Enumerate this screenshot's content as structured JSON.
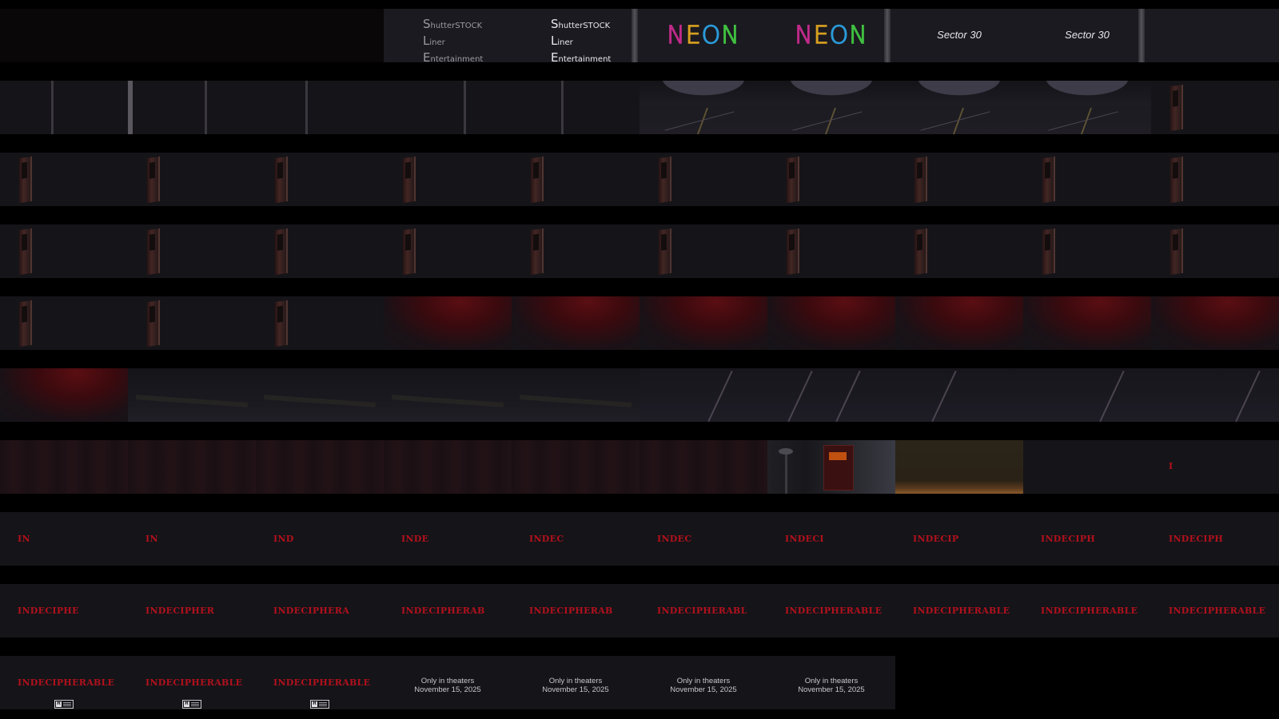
{
  "logos": {
    "shutterstock": [
      "S",
      "hutterSTOCK",
      "L",
      "iner",
      "E",
      "ntertainment"
    ],
    "neon_letters": [
      {
        "char": "N",
        "color": "#c02a8a"
      },
      {
        "char": "E",
        "color": "#d8a020"
      },
      {
        "char": "O",
        "color": "#2a9ad8"
      },
      {
        "char": "N",
        "color": "#40c040"
      }
    ],
    "sector": "Sector 30"
  },
  "title_progression_row8": [
    "IN",
    "IN",
    "IND",
    "INDE",
    "INDEC",
    "INDEC",
    "INDECI",
    "INDECIP",
    "INDECIPH",
    "INDECIPH"
  ],
  "title_progression_row9": [
    "INDECIPHE",
    "INDECIPHER",
    "INDECIPHERA",
    "INDECIPHERAB",
    "INDECIPHERAB",
    "INDECIPHERABL",
    "INDECIPHERABLE",
    "INDECIPHERABLE",
    "INDECIPHERABLE",
    "INDECIPHERABLE"
  ],
  "final_row": {
    "title": "INDECIPHERABLE",
    "rating_letter": "R",
    "release_line1": "Only in theaters",
    "release_line2": "November 15, 2025"
  },
  "single_red_mark": "I",
  "colors": {
    "title_red": "#b2111c",
    "background": "#000000",
    "frame_bg": "#151419"
  }
}
